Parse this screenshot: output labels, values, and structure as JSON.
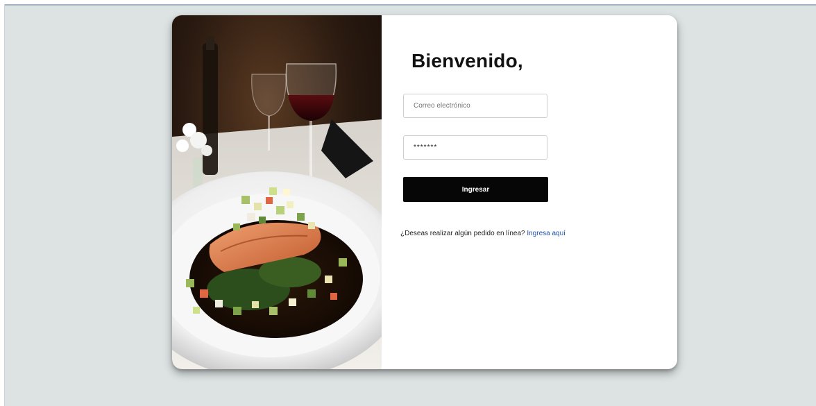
{
  "login": {
    "title": "Bienvenido,",
    "email_placeholder": "Correo electrónico",
    "password_value": "*******",
    "submit_label": "Ingresar",
    "online_prompt": "¿Deseas realizar algún pedido en línea?",
    "online_link": "Ingresa aquí"
  },
  "theme": {
    "background": "#dde3e3",
    "button": "#060606",
    "link": "#1f4fa8"
  }
}
